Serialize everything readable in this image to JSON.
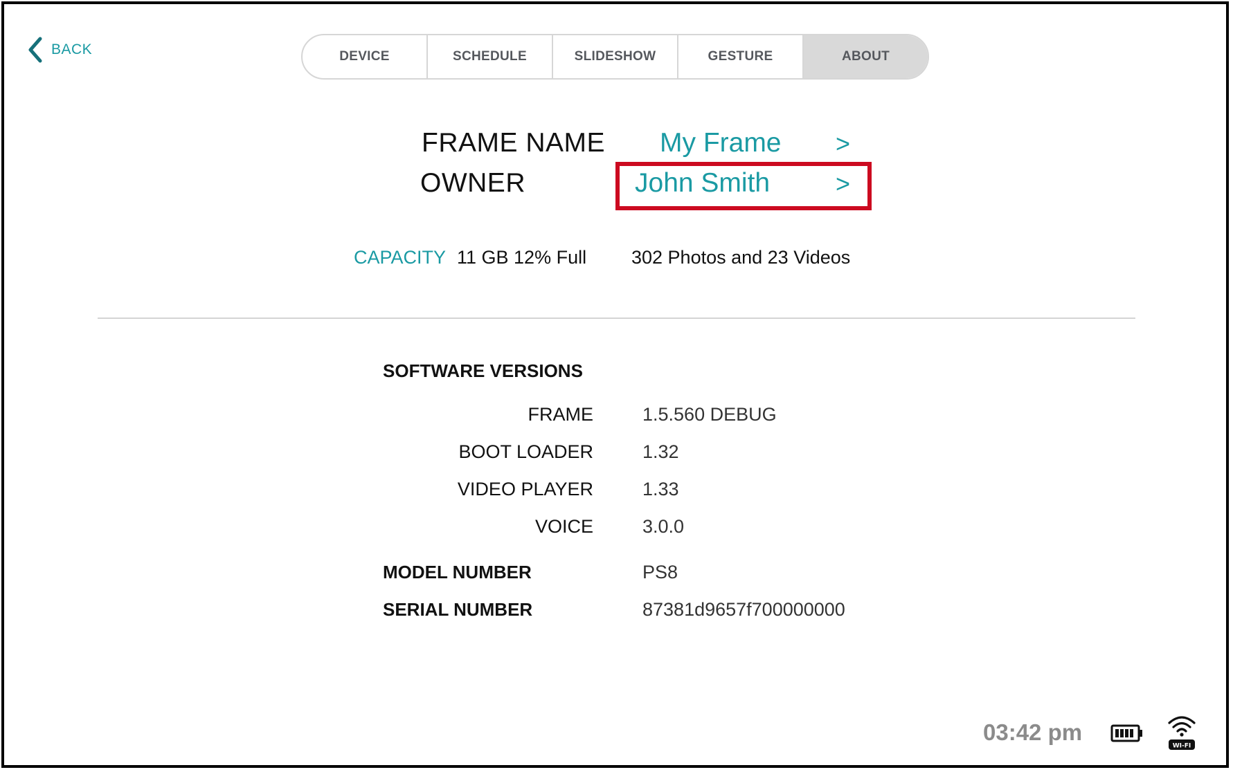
{
  "nav": {
    "back_label": "BACK"
  },
  "tabs": [
    {
      "label": "DEVICE",
      "active": false
    },
    {
      "label": "SCHEDULE",
      "active": false
    },
    {
      "label": "SLIDESHOW",
      "active": false
    },
    {
      "label": "GESTURE",
      "active": false
    },
    {
      "label": "ABOUT",
      "active": true
    }
  ],
  "frame": {
    "name_label": "FRAME NAME",
    "name_value": "My Frame",
    "owner_label": "OWNER",
    "owner_value": "John Smith",
    "chevron": ">"
  },
  "storage": {
    "capacity_label": "CAPACITY",
    "capacity_value": "11 GB 12% Full",
    "media_summary": "302  Photos and 23 Videos"
  },
  "software": {
    "heading": "SOFTWARE VERSIONS",
    "versions": [
      {
        "label": "FRAME",
        "value": "1.5.560 DEBUG"
      },
      {
        "label": "BOOT LOADER",
        "value": "1.32"
      },
      {
        "label": "VIDEO PLAYER",
        "value": "1.33"
      },
      {
        "label": "VOICE",
        "value": "3.0.0"
      }
    ],
    "model_label": "MODEL NUMBER",
    "model_value": "PS8",
    "serial_label": "SERIAL NUMBER",
    "serial_value": "87381d9657f700000000"
  },
  "status": {
    "time": "03:42 pm",
    "wifi_label": "WI-FI",
    "battery_icon": "battery-full-icon",
    "wifi_icon": "wifi-icon"
  },
  "colors": {
    "accent": "#1a9aa3",
    "highlight": "#cc0a20",
    "active_tab": "#d9d9d9"
  }
}
